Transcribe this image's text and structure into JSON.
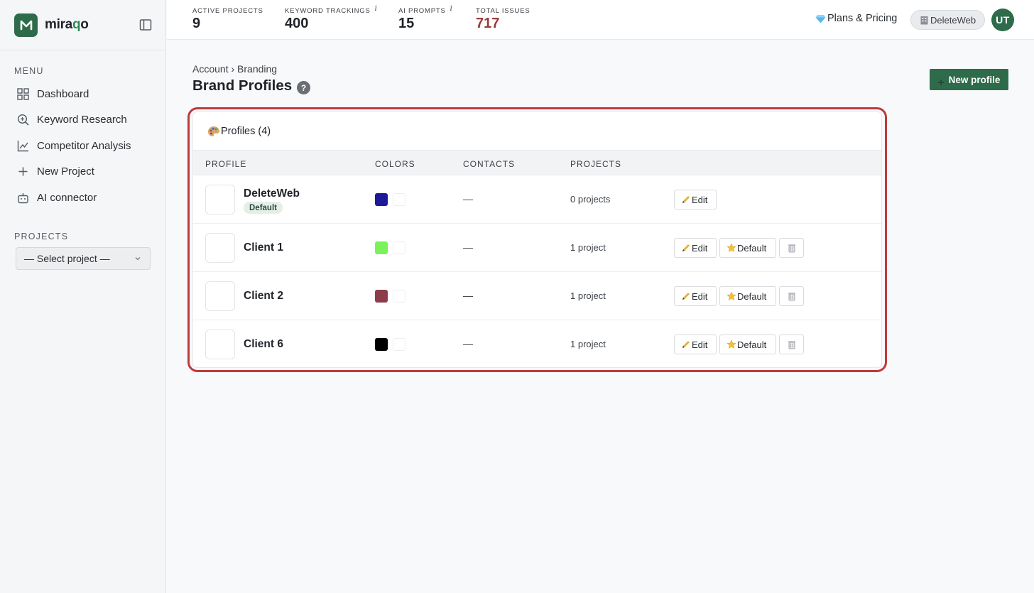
{
  "brand": {
    "name_prefix": "mira",
    "name_highlight": "q",
    "name_suffix": "o"
  },
  "sidebar": {
    "menu_label": "MENU",
    "items": [
      {
        "label": "Dashboard",
        "icon": "grid-icon"
      },
      {
        "label": "Keyword Research",
        "icon": "search-plus-icon"
      },
      {
        "label": "Competitor Analysis",
        "icon": "line-chart-icon"
      },
      {
        "label": "New Project",
        "icon": "plus-icon"
      },
      {
        "label": "AI connector",
        "icon": "robot-icon"
      }
    ],
    "projects_label": "PROJECTS",
    "select_project": "— Select project —"
  },
  "topbar": {
    "stats": [
      {
        "label": "ACTIVE PROJECTS",
        "value": "9",
        "info": ""
      },
      {
        "label": "KEYWORD TRACKINGS",
        "value": "400",
        "info": "i"
      },
      {
        "label": "AI PROMPTS",
        "value": "15",
        "info": "i"
      },
      {
        "label": "TOTAL ISSUES",
        "value": "717",
        "info": ""
      }
    ],
    "plans_label": "Plans & Pricing",
    "account_label": "DeleteWeb",
    "avatar_initials": "UT"
  },
  "main": {
    "breadcrumb": "Account › Branding",
    "title": "Brand Profiles",
    "help": "?",
    "new_profile_label": "New profile",
    "card_title": "Profiles (4)",
    "columns": [
      "PROFILE",
      "COLORS",
      "CONTACTS",
      "PROJECTS"
    ],
    "rows": [
      {
        "name": "DeleteWeb",
        "badge": "Default",
        "color1": "#1b1b9a",
        "contacts": "—",
        "projects": "0 projects",
        "edit": "Edit",
        "default": ""
      },
      {
        "name": "Client 1",
        "badge": "",
        "color1": "#7bf25a",
        "contacts": "—",
        "projects": "1 project",
        "edit": "Edit",
        "default": "Default"
      },
      {
        "name": "Client 2",
        "badge": "",
        "color1": "#8b3e4a",
        "contacts": "—",
        "projects": "1 project",
        "edit": "Edit",
        "default": "Default"
      },
      {
        "name": "Client 6",
        "badge": "",
        "color1": "#000000",
        "contacts": "—",
        "projects": "1 project",
        "edit": "Edit",
        "default": "Default"
      }
    ]
  },
  "colors": {
    "accent": "#2e6b4b",
    "issues": "#9b3a3a",
    "highlight": "#c0393b"
  }
}
